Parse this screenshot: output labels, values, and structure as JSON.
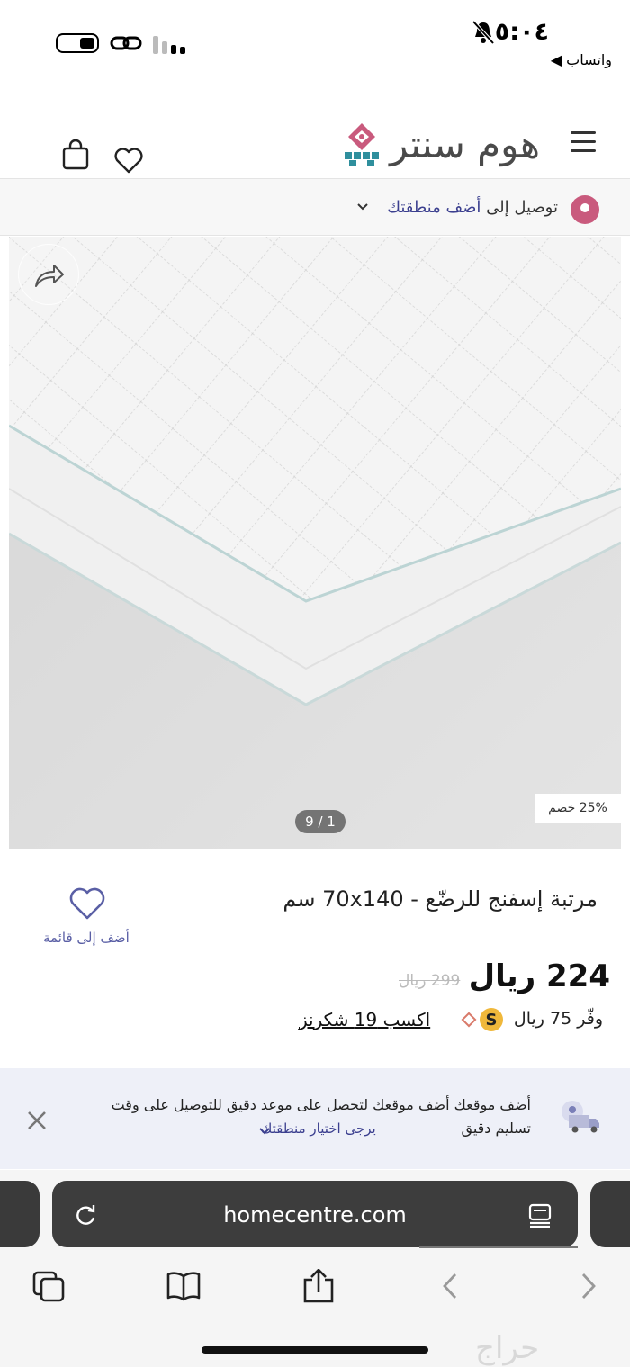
{
  "status_bar": {
    "time": "٥:٠٤",
    "back_app": "◀ واتساب",
    "icons": [
      "bell-slash-icon",
      "battery-icon",
      "link-icon",
      "signal-icon"
    ]
  },
  "header": {
    "logo_text": "هوم سنتر",
    "icons": [
      "menu-icon",
      "heart-icon",
      "shopping-bag-icon"
    ]
  },
  "delivery": {
    "prefix": "توصيل إلى",
    "link": "أضف منطقتك"
  },
  "gallery": {
    "discount_badge": "25% خصم",
    "pager": "9 / 1"
  },
  "product": {
    "title": "مرتبة إسفنج للرضّع - 70x140 سم",
    "wishlist_label": "أضف إلى قائمة",
    "price": "224 ريال",
    "old_price": "299 ريال",
    "save_text": "وفّر 75  ريال",
    "earn_link": "اكسب 19 شكرنز"
  },
  "location_banner": {
    "text": "أضف موقعك أضف موقعك لتحصل على موعد دقيق للتوصيل على وقت تسليم دقيق",
    "sub_link": "يرجى اختيار منطقتك"
  },
  "browser": {
    "url": "homecentre.com",
    "tools": [
      "tabs-icon",
      "bookmarks-icon",
      "share-icon",
      "back-icon",
      "forward-icon"
    ]
  },
  "watermark": "حراج",
  "colors": {
    "accent": "#3b3f8f",
    "pin": "#c95a7d",
    "coin": "#f0b83b",
    "banner_bg": "#eef0f8"
  }
}
